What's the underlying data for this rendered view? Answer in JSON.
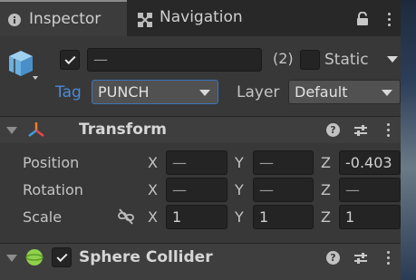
{
  "tabs": {
    "inspector_label": "Inspector",
    "navigation_label": "Navigation"
  },
  "object": {
    "active": true,
    "name_value": "—",
    "count_label": "(2)",
    "static_label": "Static",
    "static_checked": false,
    "tag_label": "Tag",
    "tag_value": "PUNCH",
    "layer_label": "Layer",
    "layer_value": "Default"
  },
  "transform": {
    "title": "Transform",
    "rows": [
      {
        "label": "Position",
        "x": "—",
        "y": "—",
        "z": "-0.403"
      },
      {
        "label": "Rotation",
        "x": "—",
        "y": "—",
        "z": "—"
      },
      {
        "label": "Scale",
        "x": "1",
        "y": "1",
        "z": "1"
      }
    ],
    "axis_x": "X",
    "axis_y": "Y",
    "axis_z": "Z"
  },
  "sphere_collider": {
    "title": "Sphere Collider",
    "enabled": true
  },
  "icons": {
    "inspector_tab": "info-icon",
    "navigation_tab": "navigation-icon",
    "lock": "lock-icon",
    "menu": "kebab-menu-icon",
    "game_object": "cube-icon",
    "transform": "transform-axes-icon",
    "collider": "sphere-collider-icon",
    "help": "help-icon",
    "presets": "presets-icon",
    "constrain": "constrain-proportions-icon"
  },
  "colors": {
    "background": "#383838",
    "tag_highlight": "#4a8ad6",
    "focus_border": "#3b74b8",
    "collider_green": "#8fd24a"
  }
}
